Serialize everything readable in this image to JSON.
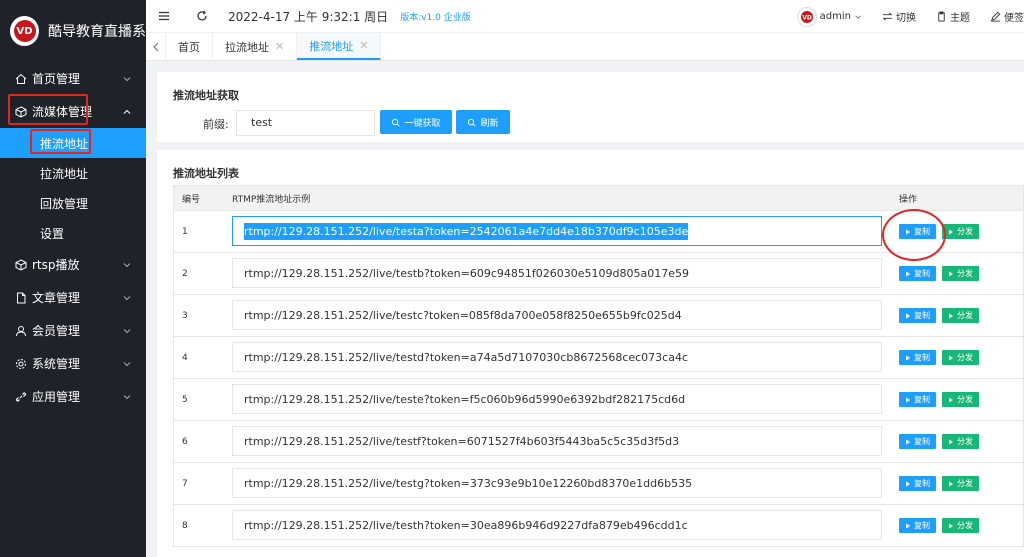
{
  "sidebar": {
    "brand_logo": "VD",
    "brand_title": "酷导教育直播系",
    "items": [
      {
        "label": "首页管理",
        "icon": "home-icon"
      },
      {
        "label": "流媒体管理",
        "icon": "cube-icon",
        "expanded": true
      },
      {
        "label": "rtsp播放",
        "icon": "cube-icon"
      },
      {
        "label": "文章管理",
        "icon": "document-icon"
      },
      {
        "label": "会员管理",
        "icon": "user-icon"
      },
      {
        "label": "系统管理",
        "icon": "gear-icon"
      },
      {
        "label": "应用管理",
        "icon": "link-icon"
      }
    ],
    "sub_items": [
      {
        "label": "推流地址",
        "active": true
      },
      {
        "label": "拉流地址"
      },
      {
        "label": "回放管理"
      },
      {
        "label": "设置"
      }
    ]
  },
  "topbar": {
    "datetime": "2022-4-17 上午 9:32:1 周日",
    "version": "版本:v1.0 企业版",
    "user": "admin",
    "switch_label": "切换",
    "theme_label": "主题",
    "note_label": "便签"
  },
  "tabs": [
    {
      "label": "首页",
      "closable": false
    },
    {
      "label": "拉流地址",
      "closable": true
    },
    {
      "label": "推流地址",
      "closable": true,
      "active": true
    }
  ],
  "fetch_card": {
    "title": "推流地址获取",
    "prefix_label": "前缀:",
    "prefix_value": "test",
    "fetch_button": "一键获取",
    "refresh_button": "刷新"
  },
  "list_card": {
    "title": "推流地址列表",
    "columns": [
      "编号",
      "RTMP推流地址示例",
      "操作"
    ],
    "copy_label": "复制",
    "share_label": "分发",
    "rows": [
      {
        "no": "1",
        "url": "rtmp://129.28.151.252/live/testa?token=2542061a4e7dd4e18b370df9c105e3de"
      },
      {
        "no": "2",
        "url": "rtmp://129.28.151.252/live/testb?token=609c94851f026030e5109d805a017e59"
      },
      {
        "no": "3",
        "url": "rtmp://129.28.151.252/live/testc?token=085f8da700e058f8250e655b9fc025d4"
      },
      {
        "no": "4",
        "url": "rtmp://129.28.151.252/live/testd?token=a74a5d7107030cb8672568cec073ca4c"
      },
      {
        "no": "5",
        "url": "rtmp://129.28.151.252/live/teste?token=f5c060b96d5990e6392bdf282175cd6d"
      },
      {
        "no": "6",
        "url": "rtmp://129.28.151.252/live/testf?token=6071527f4b603f5443ba5c5c35d3f5d3"
      },
      {
        "no": "7",
        "url": "rtmp://129.28.151.252/live/testg?token=373c93e9b10e12260bd8370e1dd6b535"
      },
      {
        "no": "8",
        "url": "rtmp://129.28.151.252/live/testh?token=30ea896b946d9227dfa879eb496cdd1c"
      }
    ]
  },
  "colors": {
    "sidebar_bg": "#20222a",
    "accent": "#1e9fff",
    "share_green": "#16b777",
    "annotation_red": "#e0261f"
  }
}
